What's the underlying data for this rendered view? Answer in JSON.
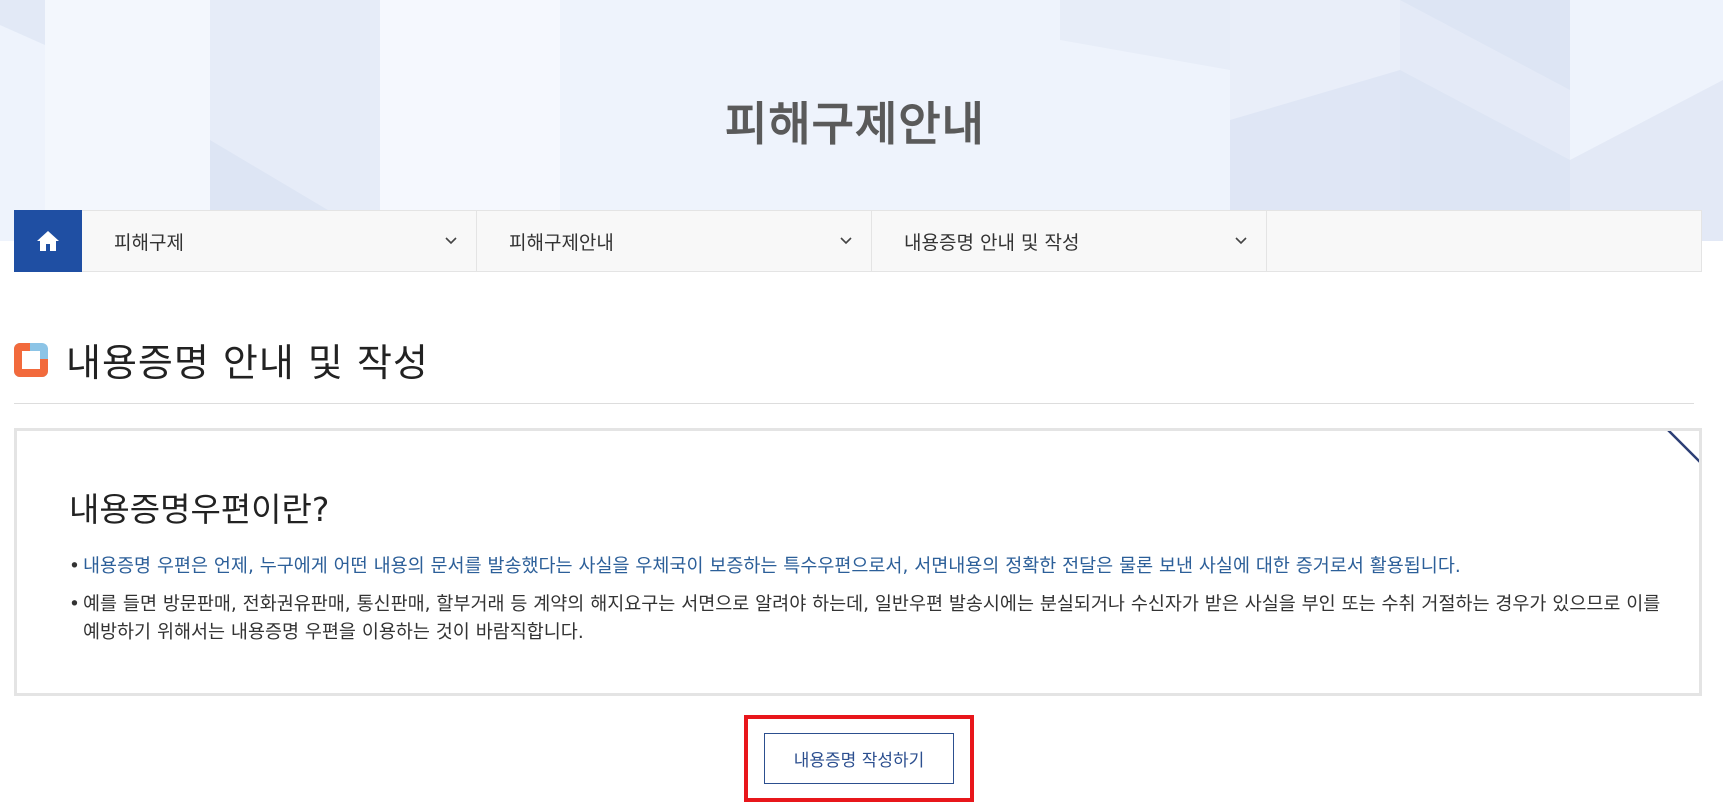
{
  "hero": {
    "title": "피해구제안내"
  },
  "breadcrumb": {
    "home_icon": "home-icon",
    "items": [
      {
        "label": "피해구제"
      },
      {
        "label": "피해구제안내"
      },
      {
        "label": "내용증명 안내 및 작성"
      }
    ]
  },
  "page": {
    "title": "내용증명 안내 및 작성"
  },
  "card": {
    "title": "내용증명우편이란?",
    "items": [
      {
        "text": "내용증명 우편은 언제, 누구에게 어떤 내용의 문서를 발송했다는 사실을 우체국이 보증하는 특수우편으로서, 서면내용의 정확한 전달은 물론 보낸 사실에 대한 증거로서 활용됩니다."
      },
      {
        "text": "예를 들면 방문판매, 전화권유판매, 통신판매, 할부거래 등 계약의 해지요구는 서면으로 알려야 하는데, 일반우편 발송시에는 분실되거나 수신자가 받은 사실을 부인 또는 수취 거절하는 경우가 있으므로 이를 예방하기 위해서는 내용증명 우편을 이용하는 것이 바람직합니다."
      }
    ]
  },
  "action": {
    "write_label": "내용증명 작성하기"
  },
  "colors": {
    "accent": "#1f4fa3",
    "link": "#2c5f99",
    "highlight": "#e8161b",
    "icon_orange": "#f26a3c",
    "icon_blue": "#8cc4e6"
  }
}
